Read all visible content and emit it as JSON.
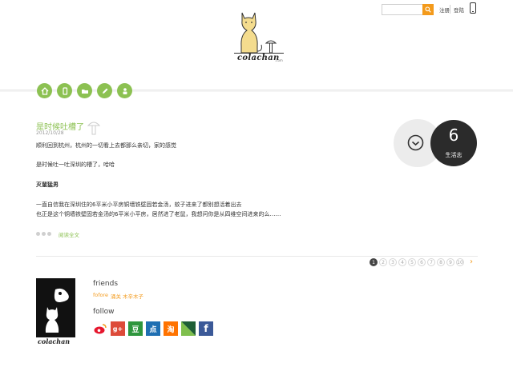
{
  "header": {
    "search_placeholder": "",
    "register": "注册",
    "login": "登陆"
  },
  "logo": {
    "text": "colachan",
    "suffix": ".com"
  },
  "nav": [
    "home-icon",
    "mobile-icon",
    "folder-icon",
    "pencil-icon",
    "person-icon"
  ],
  "post": {
    "title": "是时候吐槽了",
    "date": "2012/10/28",
    "paragraphs": [
      "顺利回到杭州，杭州的一切看上去都那么亲切，家的感觉",
      "是时候吐一吐深圳的槽了，哈哈",
      "灭鼠猛男",
      "一直自信我在深圳住的6平米小平房铜墙铁壁固若金汤，蚊子进来了都别想活着出去",
      "也正是这个铜墙铁壁固若金汤的6平米小平房，居然进了老鼠，我想问你是从四维空间进来的么……"
    ],
    "read_more": "阅读全文"
  },
  "stats": {
    "count": "6",
    "label": "生活志"
  },
  "pagination": {
    "pages": [
      "1",
      "2",
      "3",
      "4",
      "5",
      "6",
      "7",
      "8",
      "9",
      "10"
    ],
    "current": "1",
    "next": "›"
  },
  "footer": {
    "friends_title": "friends",
    "friends_links": [
      "fofore",
      "涌关",
      "木辛木子"
    ],
    "follow_title": "follow",
    "social": [
      {
        "name": "weibo-icon",
        "color": "#e6162d",
        "glyph": "◉"
      },
      {
        "name": "google-plus-icon",
        "color": "#dd4b39",
        "glyph": "g+"
      },
      {
        "name": "douban-icon",
        "color": "#2e963d",
        "glyph": "豆"
      },
      {
        "name": "dianping-icon",
        "color": "#1f6fb2",
        "glyph": "点"
      },
      {
        "name": "taobao-icon",
        "color": "#ff7300",
        "glyph": "淘"
      },
      {
        "name": "delicious-icon",
        "color": "#3d8d4f",
        "glyph": "◢"
      },
      {
        "name": "facebook-icon",
        "color": "#3b5998",
        "glyph": "f"
      }
    ]
  },
  "colors": {
    "accent_green": "#8cc152",
    "accent_orange": "#f39a1b",
    "dark": "#2b2b2b"
  }
}
